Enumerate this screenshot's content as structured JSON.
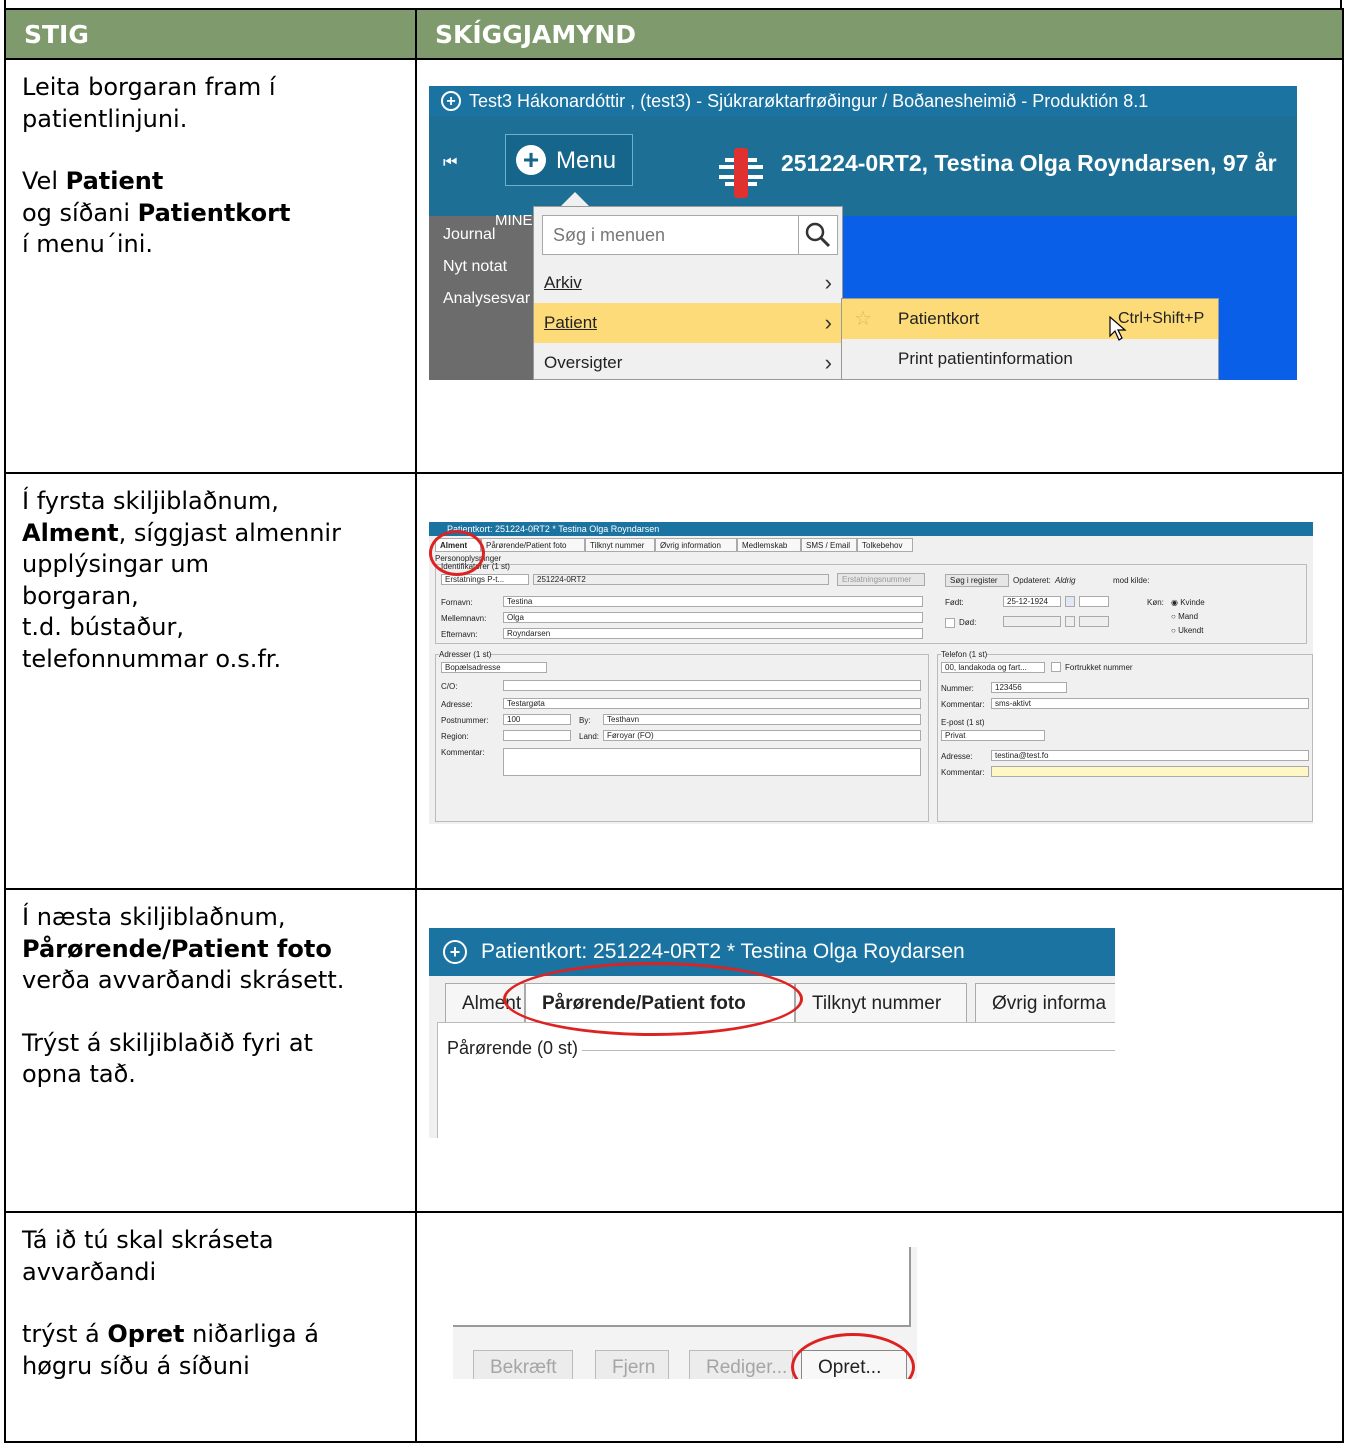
{
  "header": {
    "col1": "STIG",
    "col2": "SKÍGGJAMYND"
  },
  "steps": [
    {
      "lines": [
        [
          {
            "t": "Leita borgaran fram í"
          }
        ],
        [
          {
            "t": "patientlinjuni."
          }
        ],
        [],
        [
          {
            "t": "Vel "
          },
          {
            "t": "Patient",
            "b": true
          }
        ],
        [
          {
            "t": "og síðani "
          },
          {
            "t": "Patientkort",
            "b": true
          }
        ],
        [
          {
            "t": "í menu´ini."
          }
        ]
      ]
    },
    {
      "lines": [
        [
          {
            "t": "Í fyrsta skiljiblaðnum,"
          }
        ],
        [
          {
            "t": "Alment",
            "b": true
          },
          {
            "t": ", síggjast almennir"
          }
        ],
        [
          {
            "t": "upplýsingar um"
          }
        ],
        [
          {
            "t": "borgaran,"
          }
        ],
        [
          {
            "t": "t.d. bústaður,"
          }
        ],
        [
          {
            "t": "telefonnummar o.s.fr."
          }
        ]
      ]
    },
    {
      "lines": [
        [
          {
            "t": "Í næsta skiljiblaðnum,"
          }
        ],
        [
          {
            "t": "Pårørende/Patient foto",
            "b": true
          }
        ],
        [
          {
            "t": "verða avvarðandi skrásett."
          }
        ],
        [],
        [
          {
            "t": "Trýst á skiljiblaðið fyri at"
          }
        ],
        [
          {
            "t": "opna tað."
          }
        ]
      ]
    },
    {
      "lines": [
        [
          {
            "t": "Tá ið tú skal skráseta"
          }
        ],
        [
          {
            "t": "avvarðandi"
          }
        ],
        [],
        [
          {
            "t": "trýst á "
          },
          {
            "t": "Opret",
            "b": true
          },
          {
            "t": " niðarliga á"
          }
        ],
        [
          {
            "t": "høgru síðu á síðuni"
          }
        ]
      ]
    }
  ],
  "shot1": {
    "title": "Test3 Hákonardóttir , (test3)  - Sjúkrarøktarfrøðingur / Boðanesheimið - Produktión 8.1",
    "menu_label": "Menu",
    "patient": "251224-0RT2, Testina Olga Royndarsen, 97 år",
    "mine": "MINE",
    "side_items": [
      "Journal",
      "Nyt notat",
      "Analysesvar"
    ],
    "search_placeholder": "Søg i menuen",
    "menu_items": [
      "Arkiv",
      "Patient",
      "Oversigter"
    ],
    "submenu": [
      {
        "label": "Patientkort",
        "shortcut": "Ctrl+Shift+P"
      },
      {
        "label": "Print patientinformation",
        "shortcut": ""
      }
    ]
  },
  "shot2": {
    "title": "Patientkort: 251224-0RT2 * Testina Olga Royndarsen",
    "tabs": [
      "Alment",
      "Pårørende/Patient foto",
      "Tilknyt nummer",
      "Øvrig information",
      "Medlemskab",
      "SMS / Email",
      "Tolkebehov"
    ],
    "personoplysninger": "Personoplysninger",
    "identifikatorer": "Identifikatorer (1 st)",
    "id_type": "Erstatnings P-t...",
    "id_value": "251224-0RT2",
    "erstatningsnummer": "Erstatningsnummer",
    "sog_register": "Søg i register",
    "opdateret_label": "Opdateret:",
    "opdateret_value": "Aldrig",
    "mod_kilde": "mod kilde:",
    "fornavn_label": "Fornavn:",
    "fornavn": "Testina",
    "mellemnavn_label": "Mellemnavn:",
    "mellemnavn": "Olga",
    "efternavn_label": "Efternavn:",
    "efternavn": "Royndarsen",
    "fodt_label": "Født:",
    "fodt": "25-12-1924",
    "dod_label": "Død:",
    "kon_label": "Køn:",
    "kon_options": [
      "Kvinde",
      "Mand",
      "Ukendt"
    ],
    "adresser": "Adresser (1 st)",
    "adr_type": "Bopælsadresse",
    "co_label": "C/O:",
    "adresse_label": "Adresse:",
    "adresse": "Testargøta",
    "postnr_label": "Postnummer:",
    "postnr": "100",
    "by_label": "By:",
    "by": "Testhavn",
    "region_label": "Region:",
    "land_label": "Land:",
    "land": "Føroyar (FO)",
    "kommentar_label": "Kommentar:",
    "telefon": "Telefon (1 st)",
    "tel_type": "00, landakoda og fart...",
    "fortrukket": "Fortrukket nummer",
    "nummer_label": "Nummer:",
    "nummer": "123456",
    "tel_kommentar_label": "Kommentar:",
    "tel_kommentar": "sms-aktivt",
    "epost": "E-post (1 st)",
    "epost_type": "Privat",
    "epost_adresse_label": "Adresse:",
    "epost_adresse": "testina@test.fo",
    "epost_kommentar_label": "Kommentar:"
  },
  "shot3": {
    "title": "Patientkort: 251224-0RT2 * Testina Olga Roydarsen",
    "tabs": [
      "Alment",
      "Pårørende/Patient foto",
      "Tilknyt nummer",
      "Øvrig informa"
    ],
    "legend": "Pårørende (0 st)"
  },
  "shot4": {
    "buttons": [
      "Bekræft",
      "Fjern",
      "Rediger...",
      "Opret..."
    ]
  },
  "colors": {
    "header_bg": "#7f9a6c",
    "highlight_circle": "#dd2222",
    "titlebar": "#1a73a0"
  }
}
